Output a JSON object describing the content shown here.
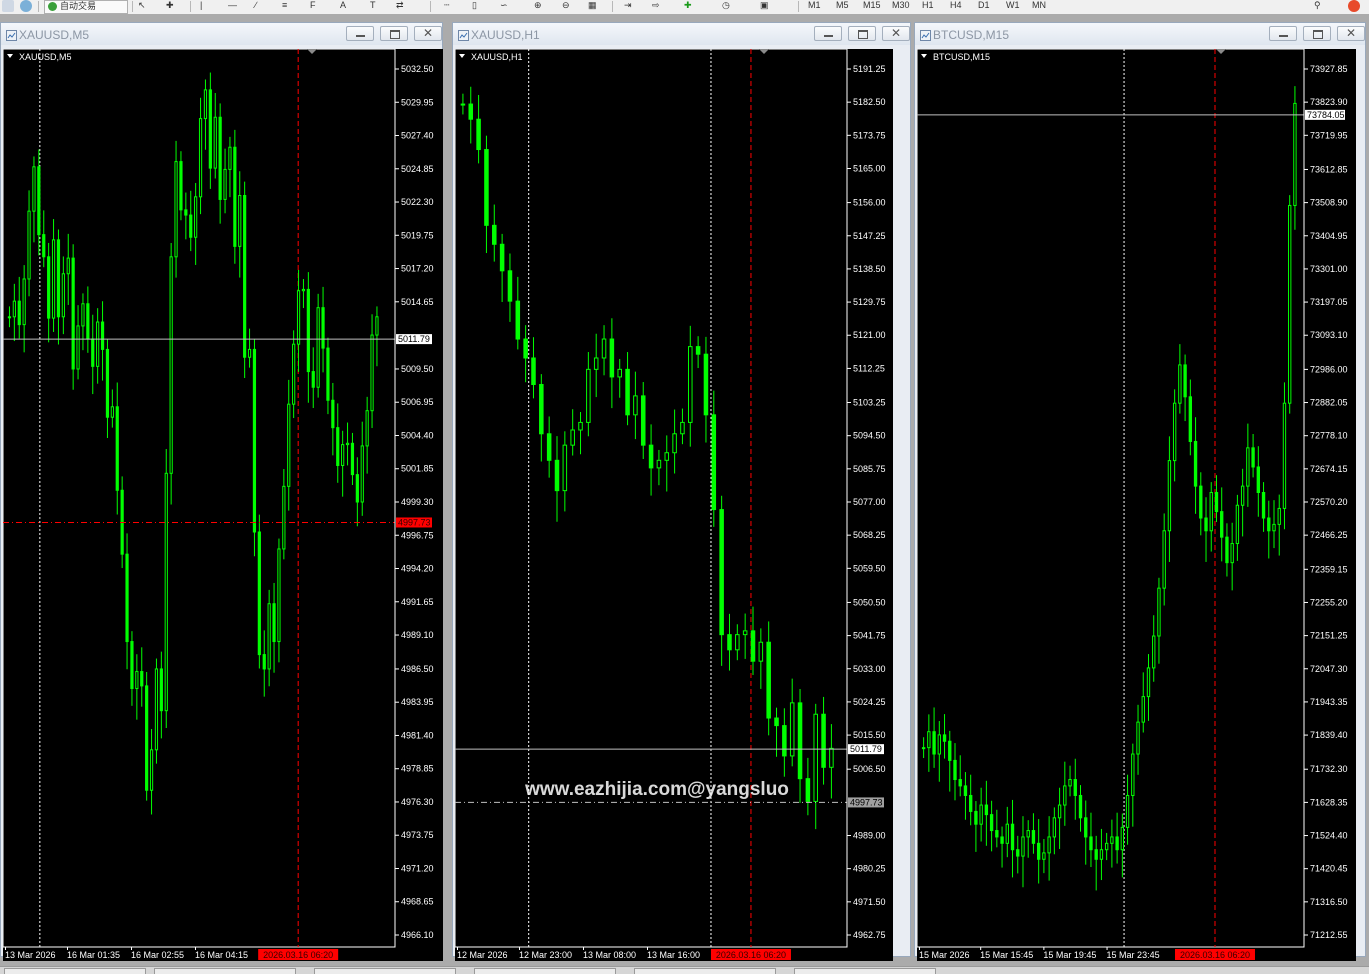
{
  "toolbar": {
    "auto_trading_label": "自动交易",
    "timeframes": [
      "M1",
      "M5",
      "M15",
      "M30",
      "H1",
      "H4",
      "D1",
      "W1",
      "MN"
    ]
  },
  "colors": {
    "bull": "#00ff00",
    "grid_text": "#ffffff",
    "ask_line": "#c0c0c0",
    "bid_line": "#ff0000",
    "period_separator": "#ffffff",
    "current_time_bg": "#ff0000"
  },
  "watermark": "www.eazhijia.com@yangsluo",
  "windows": [
    {
      "title": "XAUUSD,M5",
      "chart_label": "XAUUSD,M5",
      "price_labels": [
        "5032.50",
        "5029.95",
        "5027.40",
        "5024.85",
        "5022.30",
        "5019.75",
        "5017.20",
        "5014.65",
        "5012.10",
        "5009.50",
        "5006.95",
        "5004.40",
        "5001.85",
        "4999.30",
        "4996.75",
        "4994.20",
        "4991.65",
        "4989.10",
        "4986.50",
        "4983.95",
        "4981.40",
        "4978.85",
        "4976.30",
        "4973.75",
        "4971.20",
        "4968.65",
        "4966.10"
      ],
      "price_top": 5032.5,
      "price_bottom": 4966.1,
      "ask_price": "5011.79",
      "bid_price": "4997.73",
      "bid_label_style": "red",
      "time_labels": [
        "13 Mar 2026",
        "16 Mar 01:35",
        "16 Mar 02:55",
        "16 Mar 04:15"
      ],
      "current_time": "2026.03.16 06:20",
      "current_time_position": 0.753,
      "separator_positions": [
        0.094
      ],
      "candle_series": [
        5013.5,
        5014.7,
        5012.9,
        5016.4,
        5021.6,
        5025.0,
        5019.8,
        5018.1,
        5013.4,
        5019.4,
        5013.5,
        5016.8,
        5018.0,
        5009.5,
        5012.8,
        5014.5,
        5011.8,
        5009.7,
        5013.1,
        5011.0,
        5005.8,
        5006.6,
        5000.2,
        4995.3,
        4988.6,
        4985.0,
        4986.3,
        4985.2,
        4977.2,
        4980.3,
        4986.5,
        4983.3,
        5001.5,
        5018.1,
        5025.4,
        5021.7,
        5021.3,
        5019.6,
        5022.7,
        5028.7,
        5030.9,
        5024.9,
        5028.8,
        5022.5,
        5024.8,
        5026.5,
        5018.9,
        5022.8,
        5010.4,
        5011.0,
        4997.0,
        4987.6,
        4986.5,
        4991.5,
        4988.6,
        4995.7,
        5000.5,
        5006.8,
        5011.4,
        5015.5,
        5015.6,
        5009.3,
        5008.1,
        5014.2,
        5011.1,
        5007.1,
        5005.0,
        5002.1,
        5003.7,
        5003.8,
        5001.4,
        4999.3,
        5003.6,
        5006.3,
        5012.1,
        5013.5
      ],
      "candle_count": 80
    },
    {
      "title": "XAUUSD,H1",
      "chart_label": "XAUUSD,H1",
      "price_labels": [
        "5191.25",
        "5182.50",
        "5173.75",
        "5165.00",
        "5156.00",
        "5147.25",
        "5138.50",
        "5129.75",
        "5121.00",
        "5112.25",
        "5103.25",
        "5094.50",
        "5085.75",
        "5077.00",
        "5068.25",
        "5059.50",
        "5050.50",
        "5041.75",
        "5033.00",
        "5024.25",
        "5015.50",
        "5006.50",
        "4997.75",
        "4989.00",
        "4980.25",
        "4971.50",
        "4962.75"
      ],
      "price_top": 5191.25,
      "price_bottom": 4962.75,
      "ask_price": "5011.79",
      "bid_price": "4997.73",
      "bid_label_style": "gray",
      "time_labels": [
        "12 Mar 2026",
        "12 Mar 23:00",
        "13 Mar 08:00",
        "13 Mar 16:00"
      ],
      "current_time": "2026.03.16 06:20",
      "current_time_position": 0.755,
      "separator_positions": [
        0.188,
        0.653
      ],
      "candle_series": [
        5182.0,
        5178.0,
        5170.0,
        5150.0,
        5145.0,
        5138.0,
        5130.0,
        5120.0,
        5115.0,
        5108.0,
        5095.0,
        5088.0,
        5080.0,
        5092.0,
        5096.0,
        5098.0,
        5112.0,
        5115.0,
        5120.0,
        5110.0,
        5112.0,
        5100.0,
        5105.0,
        5092.0,
        5086.0,
        5088.0,
        5090.0,
        5095.0,
        5098.0,
        5118.0,
        5116.0,
        5100.0,
        5075.0,
        5042.0,
        5038.0,
        5042.0,
        5043.0,
        5035.0,
        5040.0,
        5020.0,
        5018.0,
        5010.0,
        5024.0,
        5004.0,
        4998.0,
        5021.0,
        5007.0,
        5012.0
      ],
      "candle_count": 50
    },
    {
      "title": "BTCUSD,M15",
      "chart_label": "BTCUSD,M15",
      "price_labels": [
        "73927.85",
        "73823.90",
        "73719.95",
        "73612.85",
        "73508.90",
        "73404.95",
        "73301.00",
        "73197.05",
        "73093.10",
        "72986.00",
        "72882.05",
        "72778.10",
        "72674.15",
        "72570.20",
        "72466.25",
        "72359.15",
        "72255.20",
        "72151.25",
        "72047.30",
        "71943.35",
        "71839.40",
        "71732.30",
        "71628.35",
        "71524.40",
        "71420.45",
        "71316.50",
        "71212.55"
      ],
      "price_top": 73927.85,
      "price_bottom": 71212.55,
      "ask_price": "73784.05",
      "bid_price": "",
      "bid_label_style": "none",
      "time_labels": [
        "15 Mar 2026",
        "15 Mar 15:45",
        "15 Mar 19:45",
        "15 Mar 23:45"
      ],
      "current_time": "2026.03.16 06:20",
      "current_time_position": 0.77,
      "separator_positions": [
        0.535
      ],
      "candle_series": [
        71800,
        71850,
        71780,
        71840,
        71820,
        71760,
        71700,
        71680,
        71650,
        71600,
        71560,
        71620,
        71590,
        71540,
        71520,
        71500,
        71560,
        71480,
        71460,
        71520,
        71540,
        71500,
        71450,
        71470,
        71520,
        71580,
        71620,
        71680,
        71700,
        71650,
        71580,
        71520,
        71480,
        71450,
        71480,
        71500,
        71520,
        71480,
        71550,
        71650,
        71780,
        71880,
        71960,
        72050,
        72150,
        72300,
        72480,
        72700,
        72880,
        73000,
        72900,
        72760,
        72620,
        72520,
        72480,
        72600,
        72540,
        72460,
        72380,
        72440,
        72560,
        72620,
        72740,
        72680,
        72600,
        72520,
        72480,
        72500,
        72550,
        72880,
        73500,
        73820
      ],
      "candle_count": 74
    }
  ],
  "status_tabs": 6
}
